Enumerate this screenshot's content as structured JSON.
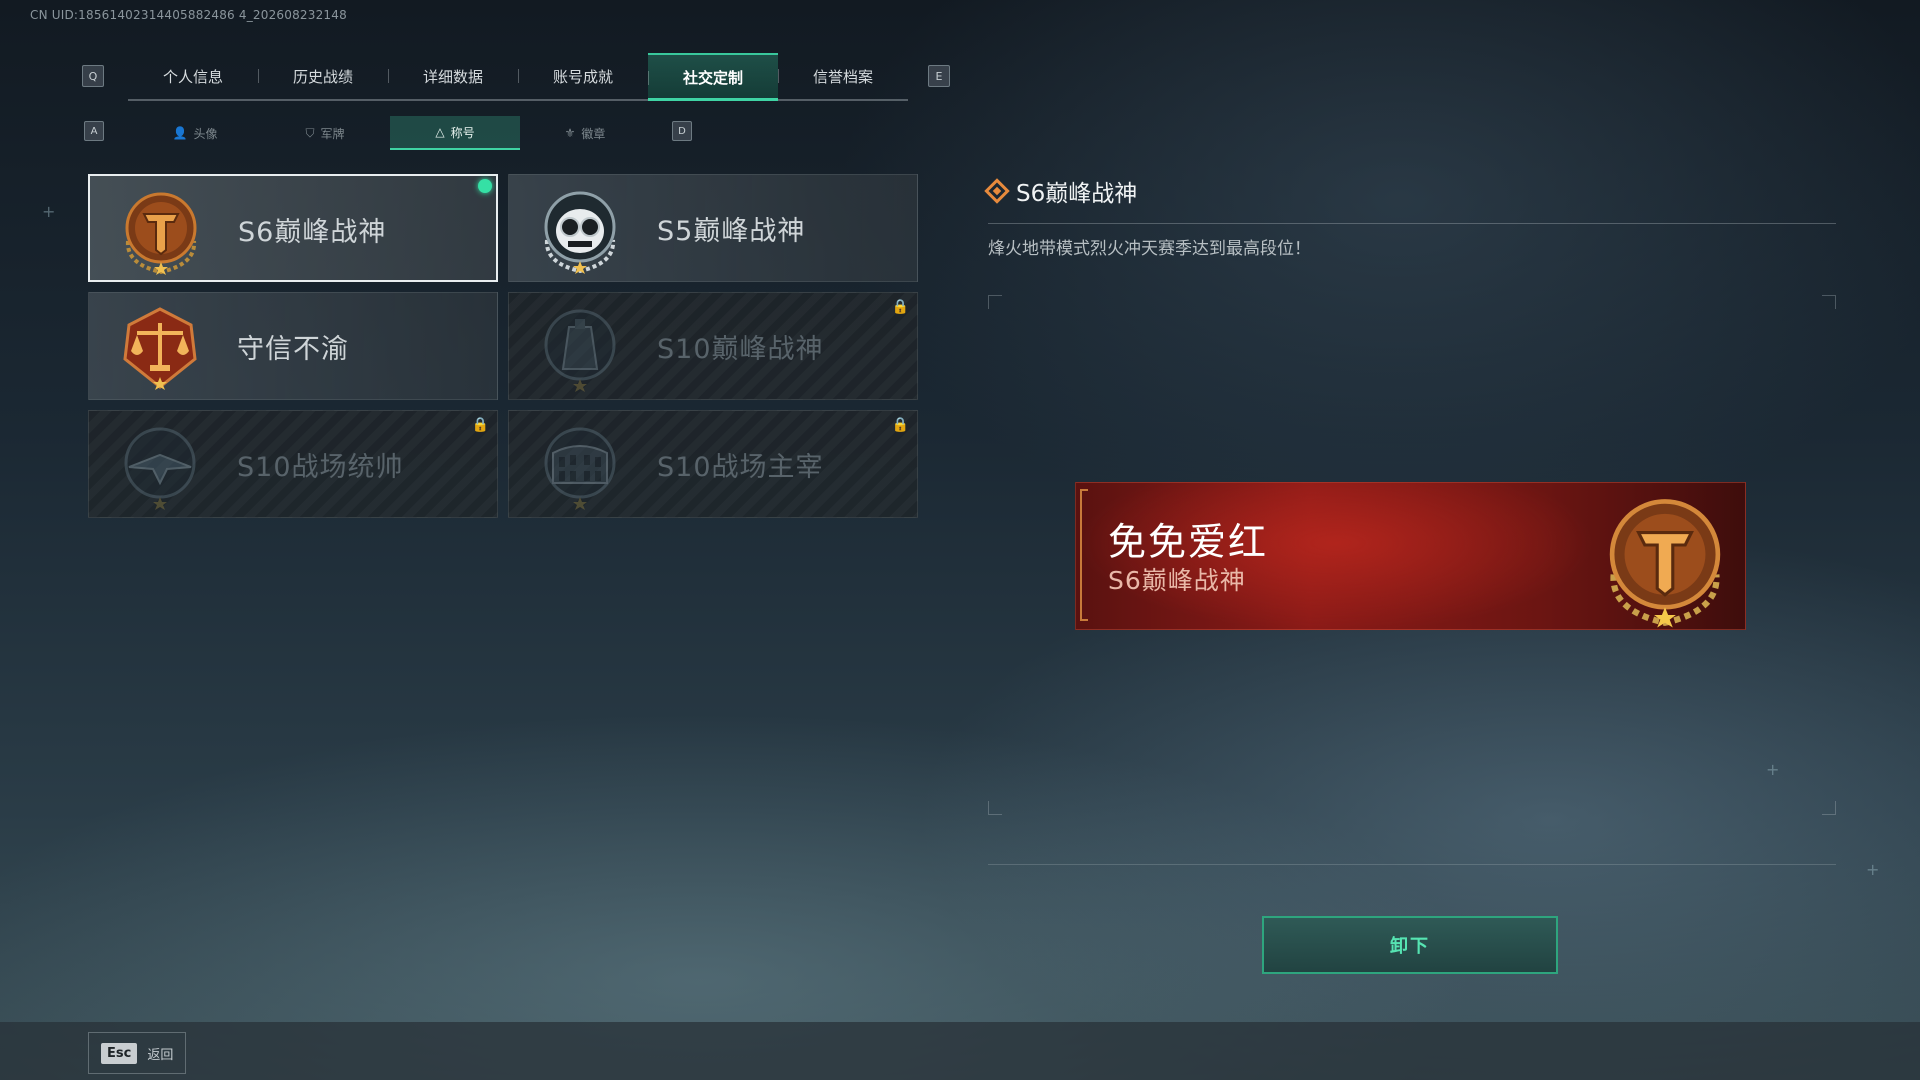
{
  "uid_text": "CN UID:18561402314405882486 4_202608232148",
  "top_tabs": {
    "left_key": "Q",
    "right_key": "E",
    "items": [
      {
        "label": "个人信息"
      },
      {
        "label": "历史战绩"
      },
      {
        "label": "详细数据"
      },
      {
        "label": "账号成就"
      },
      {
        "label": "社交定制",
        "active": true
      },
      {
        "label": "信誉档案"
      }
    ]
  },
  "sub_tabs": {
    "left_key": "A",
    "right_key": "D",
    "items": [
      {
        "label": "头像",
        "icon": "person-icon"
      },
      {
        "label": "军牌",
        "icon": "shield-icon"
      },
      {
        "label": "称号",
        "icon": "triangle-icon",
        "active": true
      },
      {
        "label": "徽章",
        "icon": "wings-icon"
      }
    ]
  },
  "titles": [
    {
      "label": "S6巅峰战神",
      "medal": "bronze-t-medal-icon",
      "selected": true,
      "equipped": true,
      "locked": false
    },
    {
      "label": "S5巅峰战神",
      "medal": "goggle-skull-medal-icon",
      "selected": false,
      "equipped": false,
      "locked": false
    },
    {
      "label": "守信不渝",
      "medal": "scales-medal-icon",
      "selected": false,
      "equipped": false,
      "locked": false
    },
    {
      "label": "S10巅峰战神",
      "medal": "tower-medal-icon",
      "selected": false,
      "equipped": false,
      "locked": true
    },
    {
      "label": "S10战场统帅",
      "medal": "jet-medal-icon",
      "selected": false,
      "equipped": false,
      "locked": true
    },
    {
      "label": "S10战场主宰",
      "medal": "colosseum-medal-icon",
      "selected": false,
      "equipped": false,
      "locked": true
    }
  ],
  "detail": {
    "title": "S6巅峰战神",
    "description": "烽火地带模式烈火冲天赛季达到最高段位！"
  },
  "banner": {
    "player_name": "免免爱红",
    "title": "S6巅峰战神"
  },
  "unequip_label": "卸下",
  "footer": {
    "esc_key": "Esc",
    "back_label": "返回"
  },
  "colors": {
    "accent": "#3fd4a4",
    "banner_red": "#8a1a17",
    "medal_bronze": "#c9792f"
  }
}
